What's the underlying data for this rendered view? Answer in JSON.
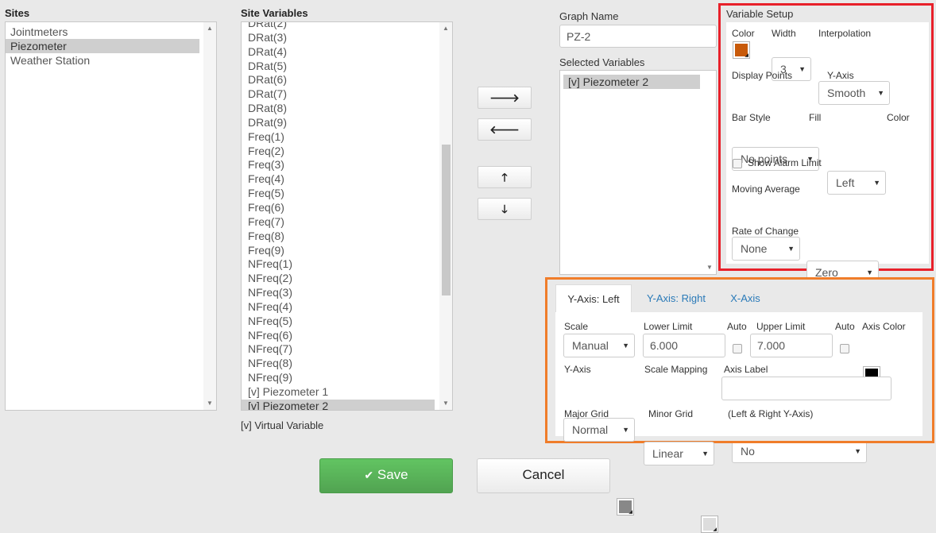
{
  "sites": {
    "label": "Sites",
    "items": [
      "Jointmeters",
      "Piezometer",
      "Weather Station"
    ],
    "selected_index": 1
  },
  "site_variables": {
    "label": "Site Variables",
    "items": [
      "DRat(2)",
      "DRat(3)",
      "DRat(4)",
      "DRat(5)",
      "DRat(6)",
      "DRat(7)",
      "DRat(8)",
      "DRat(9)",
      "Freq(1)",
      "Freq(2)",
      "Freq(3)",
      "Freq(4)",
      "Freq(5)",
      "Freq(6)",
      "Freq(7)",
      "Freq(8)",
      "Freq(9)",
      "NFreq(1)",
      "NFreq(2)",
      "NFreq(3)",
      "NFreq(4)",
      "NFreq(5)",
      "NFreq(6)",
      "NFreq(7)",
      "NFreq(8)",
      "NFreq(9)",
      "[v] Piezometer 1",
      "[v] Piezometer 2"
    ],
    "selected_index": 27,
    "footnote": "[v] Virtual Variable"
  },
  "move_buttons": {
    "right": "🡒",
    "left": "🡐",
    "up": "🡑",
    "down": "🡓"
  },
  "graph": {
    "name_label": "Graph Name",
    "name_value": "PZ-2",
    "selected_label": "Selected Variables",
    "selected_items": [
      "[v] Piezometer 2"
    ]
  },
  "variable_setup": {
    "title": "Variable Setup",
    "color_label": "Color",
    "color": "#c85a0a",
    "width_label": "Width",
    "width_value": "3",
    "interpolation_label": "Interpolation",
    "interpolation_value": "Smooth",
    "display_points_label": "Display Points",
    "display_points_value": "No points",
    "y_axis_label": "Y-Axis",
    "y_axis_value": "Left",
    "bar_style_label": "Bar Style",
    "bar_style_value": "None",
    "fill_label": "Fill",
    "fill_value": "Zero",
    "fill_color_label": "Color",
    "fill_color": "#f07d0a",
    "show_alarm_label": "Show Alarm Limit",
    "moving_average_label": "Moving Average",
    "moving_average_value": "No",
    "rate_of_change_label": "Rate of Change",
    "rate_of_change_value": "No",
    "highlight_color": "#e8202a"
  },
  "axis_panel": {
    "highlight_color": "#f07d2a",
    "tabs": [
      "Y-Axis: Left",
      "Y-Axis: Right",
      "X-Axis"
    ],
    "scale_label": "Scale",
    "scale_value": "Manual",
    "lower_limit_label": "Lower Limit",
    "lower_limit_value": "6.000",
    "auto_label": "Auto",
    "upper_limit_label": "Upper Limit",
    "upper_limit_value": "7.000",
    "auto2_label": "Auto",
    "axis_color_label": "Axis Color",
    "axis_color": "#000000",
    "y_axis_label": "Y-Axis",
    "y_axis_value": "Normal",
    "scale_mapping_label": "Scale Mapping",
    "scale_mapping_value": "Linear",
    "axis_label_label": "Axis Label",
    "axis_label_value": "",
    "major_grid_label": "Major Grid",
    "major_grid_color": "#888888",
    "minor_grid_label": "Minor Grid",
    "minor_grid_color": "#dddddd",
    "grid_note": "(Left & Right Y-Axis)"
  },
  "actions": {
    "save_label": "Save",
    "save_icon": "✔",
    "cancel_label": "Cancel"
  }
}
